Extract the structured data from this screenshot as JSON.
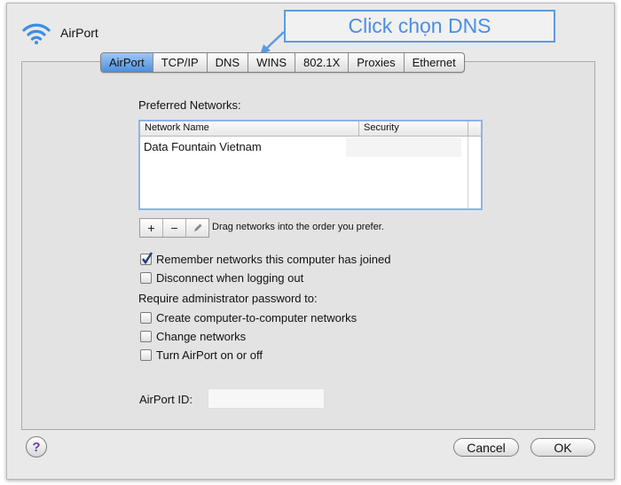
{
  "window": {
    "title": "AirPort"
  },
  "callout": {
    "text": "Click chọn DNS"
  },
  "tabs": [
    {
      "label": "AirPort",
      "active": true
    },
    {
      "label": "TCP/IP",
      "active": false
    },
    {
      "label": "DNS",
      "active": false
    },
    {
      "label": "WINS",
      "active": false
    },
    {
      "label": "802.1X",
      "active": false
    },
    {
      "label": "Proxies",
      "active": false
    },
    {
      "label": "Ethernet",
      "active": false
    }
  ],
  "preferred_networks": {
    "label": "Preferred Networks:",
    "columns": [
      "Network Name",
      "Security"
    ],
    "rows": [
      {
        "name": "Data Fountain Vietnam",
        "security": ""
      }
    ],
    "controls": {
      "add": "+",
      "remove": "−",
      "edit_icon": "pencil-icon"
    },
    "hint": "Drag networks into the order you prefer."
  },
  "options": {
    "remember": {
      "label": "Remember networks this computer has joined",
      "checked": true
    },
    "disconnect": {
      "label": "Disconnect when logging out",
      "checked": false
    }
  },
  "require_admin": {
    "label": "Require administrator password to:",
    "items": [
      {
        "label": "Create computer-to-computer networks",
        "checked": false
      },
      {
        "label": "Change networks",
        "checked": false
      },
      {
        "label": "Turn AirPort on or off",
        "checked": false
      }
    ]
  },
  "airport_id": {
    "label": "AirPort ID:",
    "value": ""
  },
  "buttons": {
    "help": "?",
    "cancel": "Cancel",
    "ok": "OK"
  },
  "colors": {
    "accent": "#4a8ee3",
    "tab_active": "#6fa6ea",
    "window_bg": "#e9e9e9"
  }
}
